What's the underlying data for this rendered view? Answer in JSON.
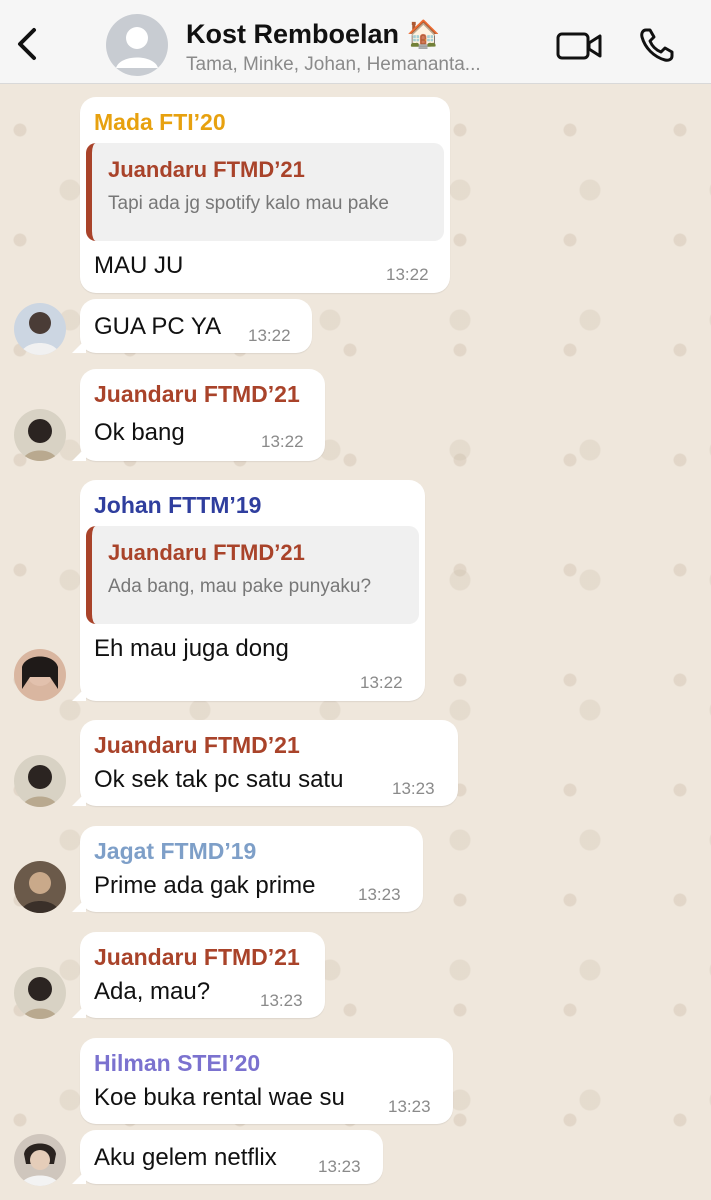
{
  "header": {
    "title": "Kost Remboelan 🏠",
    "subtitle": "Tama, Minke, Johan, Hemananta..."
  },
  "colors": {
    "mada": "#e7a10f",
    "juandaru": "#a9432a",
    "johan": "#2f3e9e",
    "jagat": "#7e9fc8",
    "hilman": "#7b72cf"
  },
  "messages": [
    {
      "sender": "Mada FTI’20",
      "quote_name": "Juandaru FTMD’21",
      "quote_text": "Tapi ada jg spotify kalo mau pake",
      "text": "MAU JU",
      "time": "13:22"
    },
    {
      "text": "GUA PC YA",
      "time": "13:22"
    },
    {
      "sender": "Juandaru FTMD’21",
      "text": "Ok bang",
      "time": "13:22"
    },
    {
      "sender": "Johan FTTM’19",
      "quote_name": "Juandaru FTMD’21",
      "quote_text": "Ada bang, mau pake punyaku?",
      "text": "Eh mau juga dong",
      "time": "13:22"
    },
    {
      "sender": "Juandaru FTMD’21",
      "text": "Ok sek tak pc satu satu",
      "time": "13:23"
    },
    {
      "sender": "Jagat FTMD’19",
      "text": "Prime ada gak prime",
      "time": "13:23"
    },
    {
      "sender": "Juandaru FTMD’21",
      "text": "Ada, mau?",
      "time": "13:23"
    },
    {
      "sender": "Hilman STEI’20",
      "text": "Koe buka rental wae su",
      "time": "13:23"
    },
    {
      "text": "Aku gelem netflix",
      "time": "13:23"
    }
  ]
}
